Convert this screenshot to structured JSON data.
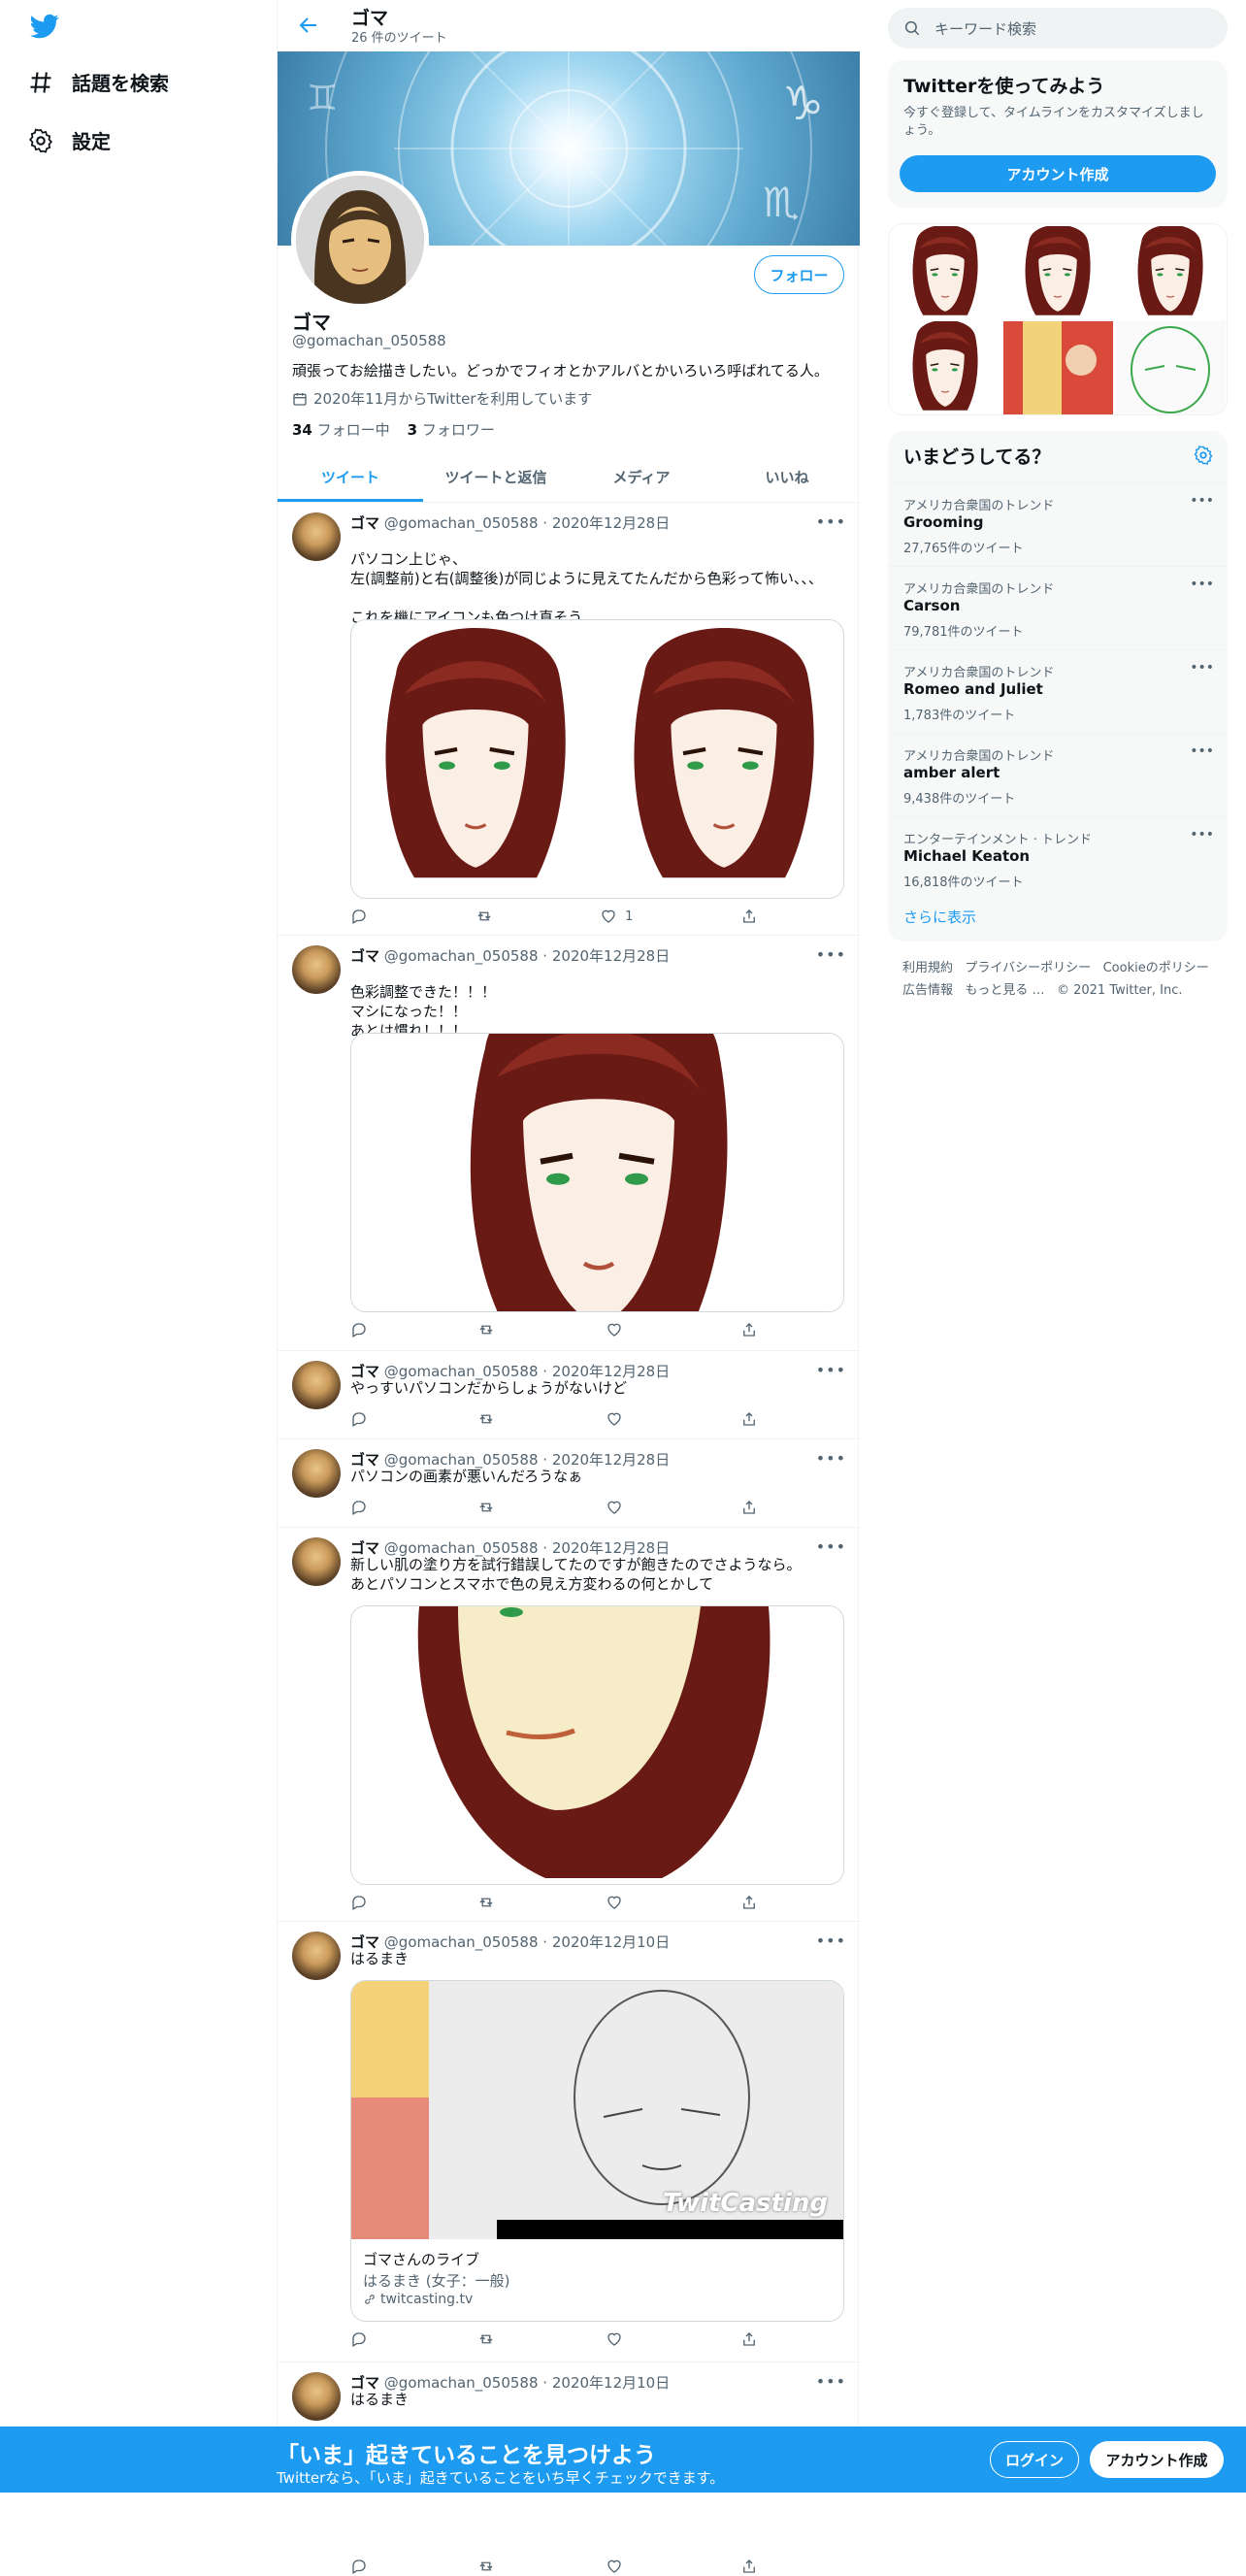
{
  "leftnav": {
    "items": [
      {
        "label": "話題を検索",
        "icon": "hashtag-icon"
      },
      {
        "label": "設定",
        "icon": "gear-icon"
      }
    ]
  },
  "header": {
    "name": "ゴマ",
    "tweet_count": "26 件のツイート"
  },
  "profile": {
    "name": "ゴマ",
    "handle": "@gomachan_050588",
    "bio": "頑張ってお絵描きしたい。どっかでフィオとかアルバとかいろいろ呼ばれてる人。",
    "joined": "2020年11月からTwitterを利用しています",
    "following_count": "34",
    "following_label": "フォロー中",
    "followers_count": "3",
    "followers_label": "フォロワー",
    "follow_button": "フォロー"
  },
  "tabs": [
    "ツイート",
    "ツイートと返信",
    "メディア",
    "いいね"
  ],
  "tweets": [
    {
      "name": "ゴマ",
      "handle": "@gomachan_050588",
      "sep": "·",
      "date": "2020年12月28日",
      "text": "パソコン上じゃ、\n左(調整前)と右(調整後)が同じように見えてたんだから色彩って怖い、、、\n\nこれを機にアイコンも色つけ直そう、、、",
      "likes": "1"
    },
    {
      "name": "ゴマ",
      "handle": "@gomachan_050588",
      "sep": "·",
      "date": "2020年12月28日",
      "text": "色彩調整できた！！！\nマシになった！！\nあとは慣れ！！！",
      "likes": ""
    },
    {
      "name": "ゴマ",
      "handle": "@gomachan_050588",
      "sep": "·",
      "date": "2020年12月28日",
      "text": "やっすいパソコンだからしょうがないけど",
      "likes": ""
    },
    {
      "name": "ゴマ",
      "handle": "@gomachan_050588",
      "sep": "·",
      "date": "2020年12月28日",
      "text": "パソコンの画素が悪いんだろうなぁ",
      "likes": ""
    },
    {
      "name": "ゴマ",
      "handle": "@gomachan_050588",
      "sep": "·",
      "date": "2020年12月28日",
      "text": "新しい肌の塗り方を試行錯誤してたのですが飽きたのでさようなら。\nあとパソコンとスマホで色の見え方変わるの何とかして",
      "likes": ""
    },
    {
      "name": "ゴマ",
      "handle": "@gomachan_050588",
      "sep": "·",
      "date": "2020年12月10日",
      "text": "はるまき",
      "likes": "",
      "card": {
        "title": "ゴマさんのライブ",
        "desc": "はるまき (女子：一般)",
        "domain": "twitcasting.tv",
        "brand": "TwitCasting"
      }
    },
    {
      "name": "ゴマ",
      "handle": "@gomachan_050588",
      "sep": "·",
      "date": "2020年12月10日",
      "text": "はるまき",
      "likes": ""
    }
  ],
  "search": {
    "placeholder": "キーワード検索"
  },
  "signup_card": {
    "title": "Twitterを使ってみよう",
    "desc": "今すぐ登録して、タイムラインをカスタマイズしましょう。",
    "button": "アカウント作成"
  },
  "trends": {
    "title": "いまどうしてる？",
    "items": [
      {
        "context": "アメリカ合衆国のトレンド",
        "name": "Grooming",
        "count": "27,765件のツイート"
      },
      {
        "context": "アメリカ合衆国のトレンド",
        "name": "Carson",
        "count": "79,781件のツイート"
      },
      {
        "context": "アメリカ合衆国のトレンド",
        "name": "Romeo and Juliet",
        "count": "1,783件のツイート"
      },
      {
        "context": "アメリカ合衆国のトレンド",
        "name": "amber alert",
        "count": "9,438件のツイート"
      },
      {
        "context": "エンターテインメント · トレンド",
        "name": "Michael Keaton",
        "count": "16,818件のツイート"
      }
    ],
    "more": "さらに表示"
  },
  "footer": {
    "links": [
      "利用規約",
      "プライバシーポリシー",
      "Cookieのポリシー",
      "広告情報",
      "もっと見る …"
    ],
    "copyright": "© 2021 Twitter, Inc."
  },
  "bottombar": {
    "headline": "「いま」起きていることを見つけよう",
    "sub": "Twitterなら、「いま」起きていることをいち早くチェックできます。",
    "login": "ログイン",
    "signup": "アカウント作成"
  },
  "colors": {
    "accent": "#1d9bf0",
    "text": "#0f1419",
    "muted": "#536471",
    "hair": "#6a1a14"
  }
}
